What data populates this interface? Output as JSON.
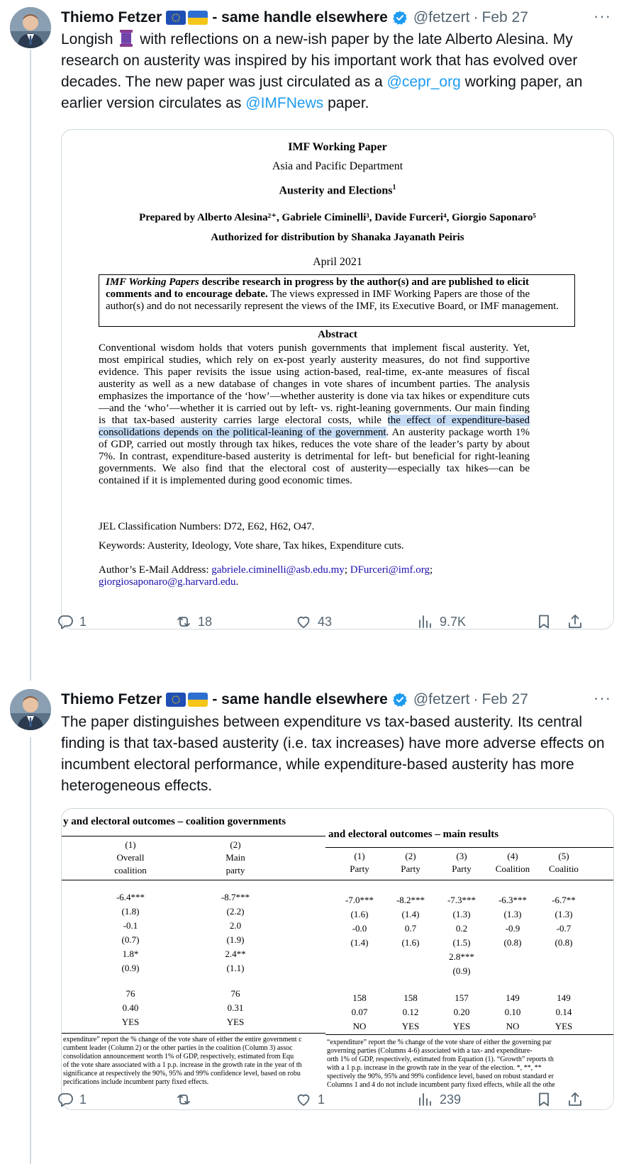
{
  "tweet1": {
    "author_name": "Thiemo Fetzer",
    "name_suffix": "- same handle elsewhere",
    "handle": "@fetzert",
    "dot": "·",
    "date": "Feb 27",
    "more": "···",
    "text": {
      "p1": "Longish",
      "p2": "with reflections on a new-ish paper by the late Alberto Alesina. My research on austerity was inspired by his important work that has evolved over decades. The new paper was just circulated as a",
      "mention1": "@cepr_org",
      "p3": "working paper, an earlier version circulates as",
      "mention2": "@IMFNews",
      "p4": "paper."
    },
    "image": {
      "title": "IMF Working Paper",
      "department": "Asia and Pacific Department",
      "paper_title": "Austerity and Elections",
      "paper_title_sup": "1",
      "authors": "Prepared by Alberto Alesina²⁺, Gabriele Ciminelli³, Davide Furceri⁴, Giorgio Saponaro⁵",
      "authorized": "Authorized for distribution by Shanaka Jayanath Peiris",
      "date": "April 2021",
      "box_bold_italic": "IMF Working Papers",
      "box_bold": "describe research in progress by the author(s) and are published to elicit comments and to encourage debate.",
      "box_rest": "The views expressed in IMF Working Papers are those of the author(s) and do not necessarily represent the views of the IMF, its Executive Board, or IMF management.",
      "abstract_heading": "Abstract",
      "abstract_pre": "Conventional wisdom holds that voters punish governments that implement fiscal austerity. Yet, most empirical studies, which rely on ex-post yearly austerity measures, do not find supportive evidence. This paper revisits the issue using action-based, real-time, ex-ante measures of fiscal austerity as well as a new database of changes in vote shares of incumbent parties. The analysis emphasizes the importance of the ‘how’—whether austerity is done via tax hikes or expenditure cuts—and the ‘who’—whether it is carried out by left- vs. right-leaning governments. Our main finding is that tax-based austerity carries large electoral costs, while",
      "abstract_highlight": "the effect of expenditure-based consolidations depends on the political-leaning of the government",
      "abstract_post": ". An austerity package worth 1% of GDP, carried out mostly through tax hikes, reduces the vote share of the leader’s party by about 7%. In contrast, expenditure-based austerity is detrimental for left- but beneficial for right-leaning governments. We also find that the electoral cost of austerity—especially tax hikes—can be contained if it is implemented during good economic times.",
      "jel": "JEL Classification Numbers: D72, E62, H62, O47.",
      "keywords": "Keywords: Austerity, Ideology, Vote share, Tax hikes, Expenditure cuts.",
      "email_label": "Author’s E-Mail Address:",
      "email1": "gabriele.ciminelli@asb.edu.my",
      "email_sep": ";",
      "email2": "DFurceri@imf.org",
      "email_sep2": ";",
      "email3": "giorgiosaponaro@g.harvard.edu",
      "email_end": "."
    },
    "actions": {
      "replies": "1",
      "retweets": "18",
      "likes": "43",
      "views": "9.7K"
    }
  },
  "tweet2": {
    "author_name": "Thiemo Fetzer",
    "name_suffix": "- same handle elsewhere",
    "handle": "@fetzert",
    "dot": "·",
    "date": "Feb 27",
    "more": "···",
    "text": "The paper distinguishes between expenditure vs tax-based austerity. Its central finding is that tax-based austerity (i.e. tax increases) have more adverse effects on incumbent electoral performance, while expenditure-based austerity has more heterogeneous  effects.",
    "image": {
      "left_title": "y and electoral outcomes – coalition governments",
      "left_headers": [
        [
          "(1)",
          "Overall",
          "coalition"
        ],
        [
          "(2)",
          "Main",
          "party"
        ]
      ],
      "left_rows": [
        [
          "-6.4***",
          "-8.7***"
        ],
        [
          "(1.8)",
          "(2.2)"
        ],
        [
          "-0.1",
          "2.0"
        ],
        [
          "(0.7)",
          "(1.9)"
        ],
        [
          "1.8*",
          "2.4**"
        ],
        [
          "(0.9)",
          "(1.1)"
        ],
        [
          "76",
          "76"
        ],
        [
          "0.40",
          "0.31"
        ],
        [
          "YES",
          "YES"
        ]
      ],
      "left_notes": [
        "expenditure” report the % change of the vote share of either the entire government c",
        "cumbent leader (Column 2) or the other parties in the coalition (Column 3) assoc",
        "consolidation announcement worth 1% of GDP, respectively, estimated from Equ",
        "of the vote share associated with a 1 p.p. increase in the growth rate in the year of th",
        "significance at respectively the 90%, 95% and 99% confidence level, based on robu",
        "pecifications include incumbent party fixed effects."
      ],
      "right_title": "and electoral outcomes – main results",
      "right_headers": [
        [
          "(1)",
          "Party"
        ],
        [
          "(2)",
          "Party"
        ],
        [
          "(3)",
          "Party"
        ],
        [
          "(4)",
          "Coalition"
        ],
        [
          "(5)",
          "Coalitio"
        ]
      ],
      "right_rows": [
        [
          "-7.0***",
          "-8.2***",
          "-7.3***",
          "-6.3***",
          "-6.7**"
        ],
        [
          "(1.6)",
          "(1.4)",
          "(1.3)",
          "(1.3)",
          "(1.3)"
        ],
        [
          "-0.0",
          "0.7",
          "0.2",
          "-0.9",
          "-0.7"
        ],
        [
          "(1.4)",
          "(1.6)",
          "(1.5)",
          "(0.8)",
          "(0.8)"
        ],
        [
          "",
          "",
          "2.8***",
          "",
          ""
        ],
        [
          "",
          "",
          "(0.9)",
          "",
          ""
        ],
        [
          "158",
          "158",
          "157",
          "149",
          "149"
        ],
        [
          "0.07",
          "0.12",
          "0.20",
          "0.10",
          "0.14"
        ],
        [
          "NO",
          "YES",
          "YES",
          "NO",
          "YES"
        ]
      ],
      "right_notes": [
        "“expenditure” report the % change of the vote share of either the governing par",
        "governing parties (Columns 4-6) associated with a tax- and expenditure-",
        "orth 1% of GDP, respectively, estimated from Equation (1). “Growth” reports th",
        "with a 1 p.p. increase in the growth rate in the year of the election. *, **, **",
        "spectively the 90%, 95% and 99% confidence level, based on robust standard er",
        "Columns 1 and 4 do not include incumbent party fixed effects, while all the othe"
      ]
    },
    "actions": {
      "replies": "1",
      "retweets": "",
      "likes": "1",
      "views": "239"
    }
  },
  "colors": {
    "link": "#1d9bf0",
    "muted": "#536471",
    "verified": "#1d9bf0",
    "border": "#cfd9de",
    "highlight": "#c6dcf5"
  },
  "icons": [
    "reply-icon",
    "retweet-icon",
    "like-icon",
    "views-icon",
    "bookmark-icon",
    "share-icon",
    "verified-icon",
    "eu-flag-icon",
    "ukraine-flag-icon",
    "thread-icon"
  ]
}
